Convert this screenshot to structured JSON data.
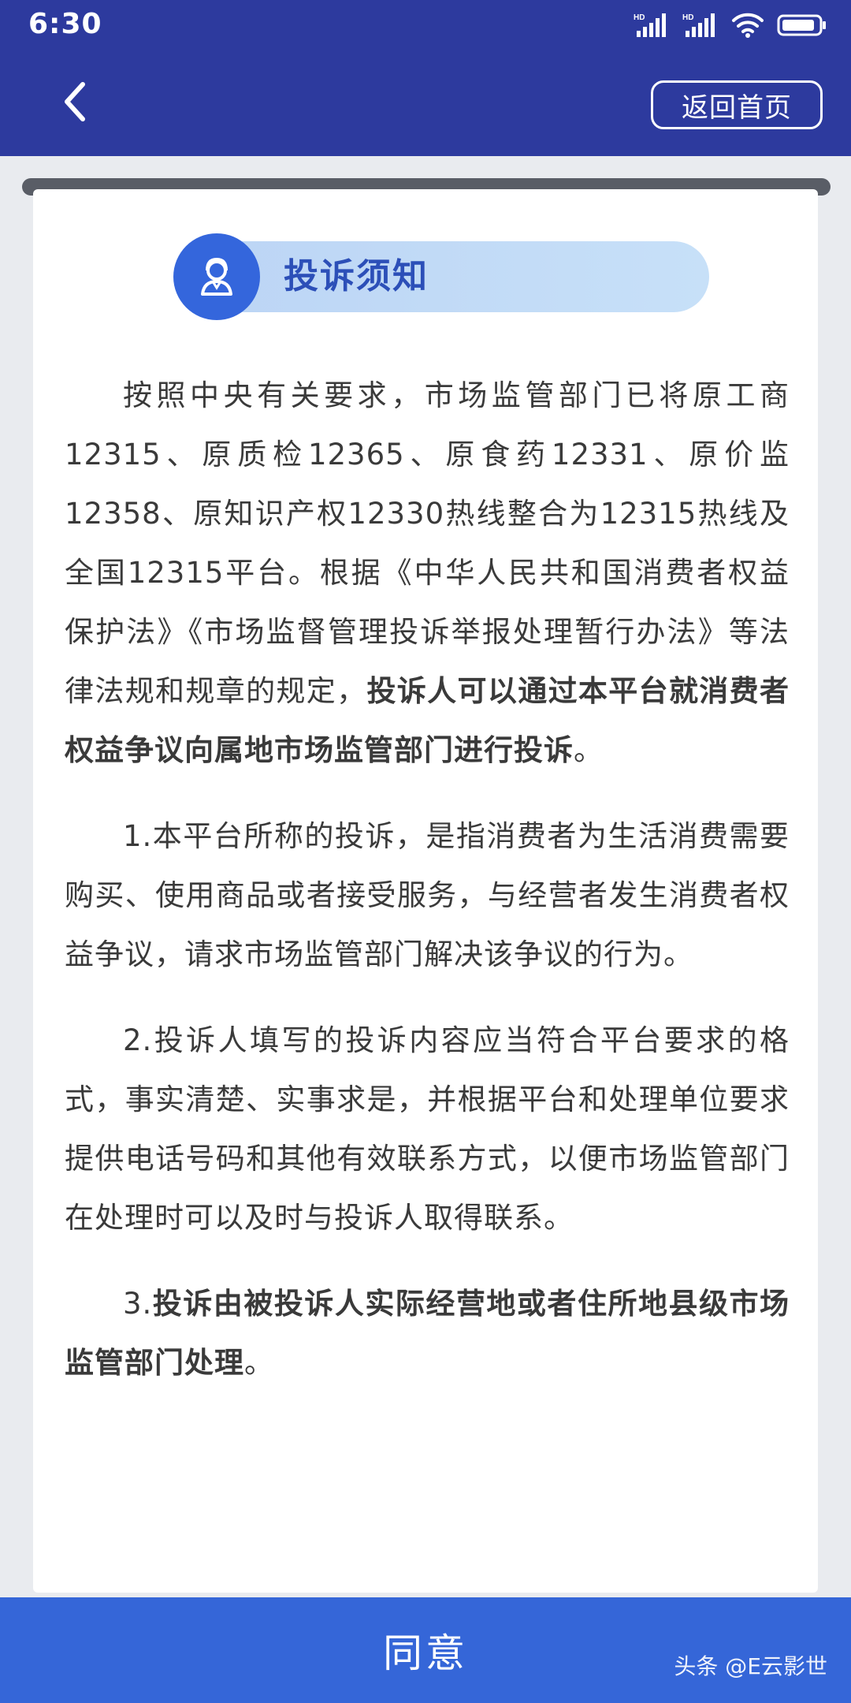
{
  "status_bar": {
    "time": "6:30",
    "signal1_label": "HD",
    "signal2_label": "HD",
    "icons": [
      "signal-icon",
      "signal-icon",
      "wifi-icon",
      "battery-icon"
    ]
  },
  "header": {
    "back_icon": "chevron-left-icon",
    "home_button": "返回首页"
  },
  "notice": {
    "icon": "user-service-icon",
    "title": "投诉须知"
  },
  "content": {
    "p1_normal": "按照中央有关要求，市场监管部门已将原工商12315、原质检12365、原食药12331、原价监12358、原知识产权12330热线整合为12315热线及全国12315平台。根据《中华人民共和国消费者权益保护法》《市场监督管理投诉举报处理暂行办法》等法律法规和规章的规定，",
    "p1_bold": "投诉人可以通过本平台就消费者权益争议向属地市场监管部门进行投诉",
    "p1_end": "。",
    "p2": "1.本平台所称的投诉，是指消费者为生活消费需要购买、使用商品或者接受服务，与经营者发生消费者权益争议，请求市场监管部门解决该争议的行为。",
    "p3": "2.投诉人填写的投诉内容应当符合平台要求的格式，事实清楚、实事求是，并根据平台和处理单位要求提供电话号码和其他有效联系方式，以便市场监管部门在处理时可以及时与投诉人取得联系。",
    "p4_prefix": "3.",
    "p4_bold": "投诉由被投诉人实际经营地或者住所地县级市场监管部门处理",
    "p4_end": "。"
  },
  "footer": {
    "agree_button": "同意",
    "watermark": "头条 @E云影世"
  },
  "colors": {
    "header_bg": "#2d3a9e",
    "accent_blue": "#3466dc",
    "title_text": "#2c4fb8",
    "agree_bg": "#3566d8"
  }
}
